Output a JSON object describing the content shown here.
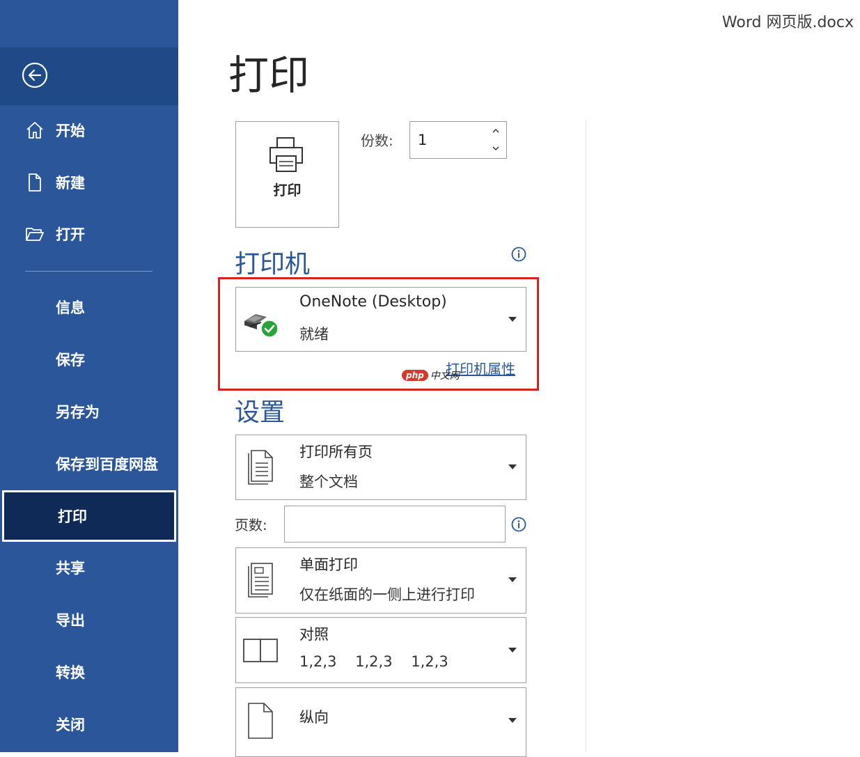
{
  "window": {
    "title": "Word 网页版.docx"
  },
  "sidebar": {
    "back_icon": "back-arrow-circle-icon",
    "items": [
      {
        "label": "开始",
        "icon": "home-icon"
      },
      {
        "label": "新建",
        "icon": "new-document-icon"
      },
      {
        "label": "打开",
        "icon": "folder-open-icon"
      },
      {
        "label": "信息"
      },
      {
        "label": "保存"
      },
      {
        "label": "另存为"
      },
      {
        "label": "保存到百度网盘"
      },
      {
        "label": "打印",
        "selected": true
      },
      {
        "label": "共享"
      },
      {
        "label": "导出"
      },
      {
        "label": "转换"
      },
      {
        "label": "关闭"
      }
    ]
  },
  "main": {
    "title": "打印",
    "print_button": {
      "label": "打印",
      "icon": "printer-icon"
    },
    "copies": {
      "label": "份数:",
      "value": "1"
    },
    "printer_section": {
      "title": "打印机",
      "printer_name": "OneNote (Desktop)",
      "status": "就绪",
      "properties_link": "打印机属性"
    },
    "settings_section": {
      "title": "设置",
      "range": {
        "line1": "打印所有页",
        "line2": "整个文档"
      },
      "pages": {
        "label": "页数:",
        "value": ""
      },
      "sides": {
        "line1": "单面打印",
        "line2": "仅在纸面的一侧上进行打印"
      },
      "collation": {
        "line1": "对照",
        "line2": "1,2,3    1,2,3    1,2,3"
      },
      "orientation": {
        "line1": "纵向"
      }
    }
  },
  "watermark": {
    "badge": "php",
    "text": "中文网"
  },
  "colors": {
    "sidebar": "#2b579a",
    "sidebar_selected": "#0f2a57",
    "accent": "#2b579a",
    "highlight": "#d9221c"
  }
}
